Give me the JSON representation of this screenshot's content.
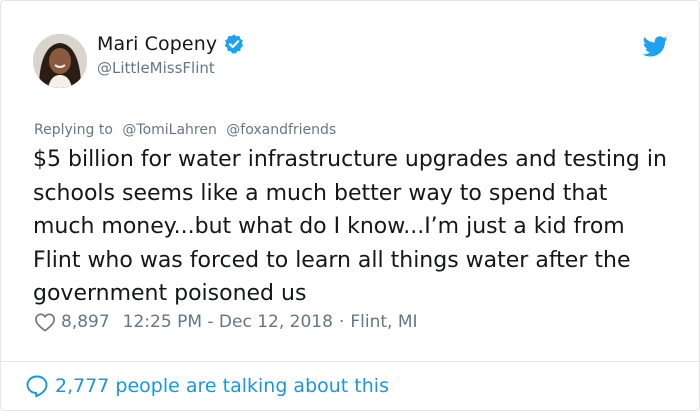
{
  "tweet": {
    "author_name": "Mari Copeny",
    "author_handle": "@LittleMissFlint",
    "replying_to_label": "Replying to",
    "replying_to_mentions": [
      "@TomiLahren",
      "@foxandfriends"
    ],
    "text": "$5 billion for water infrastructure upgrades and testing in schools seems like a much better way to spend that much money...but what do I know...I’m just a kid from Flint who was forced to learn all things water after the government poisoned us",
    "like_count": "8,897",
    "timestamp": "12:25 PM - Dec 12, 2018",
    "location": "Flint, MI",
    "separator": "·",
    "talking_text": "2,777 people are talking about this"
  },
  "icons": {
    "verified": "verified-badge-icon",
    "bird": "twitter-bird-icon",
    "heart": "heart-icon",
    "bubble": "speech-bubble-icon"
  },
  "colors": {
    "accent": "#1da1f2",
    "link": "#1b95e0",
    "secondary_text": "#657786",
    "primary_text": "#14171a",
    "border": "#e1e8ed"
  }
}
